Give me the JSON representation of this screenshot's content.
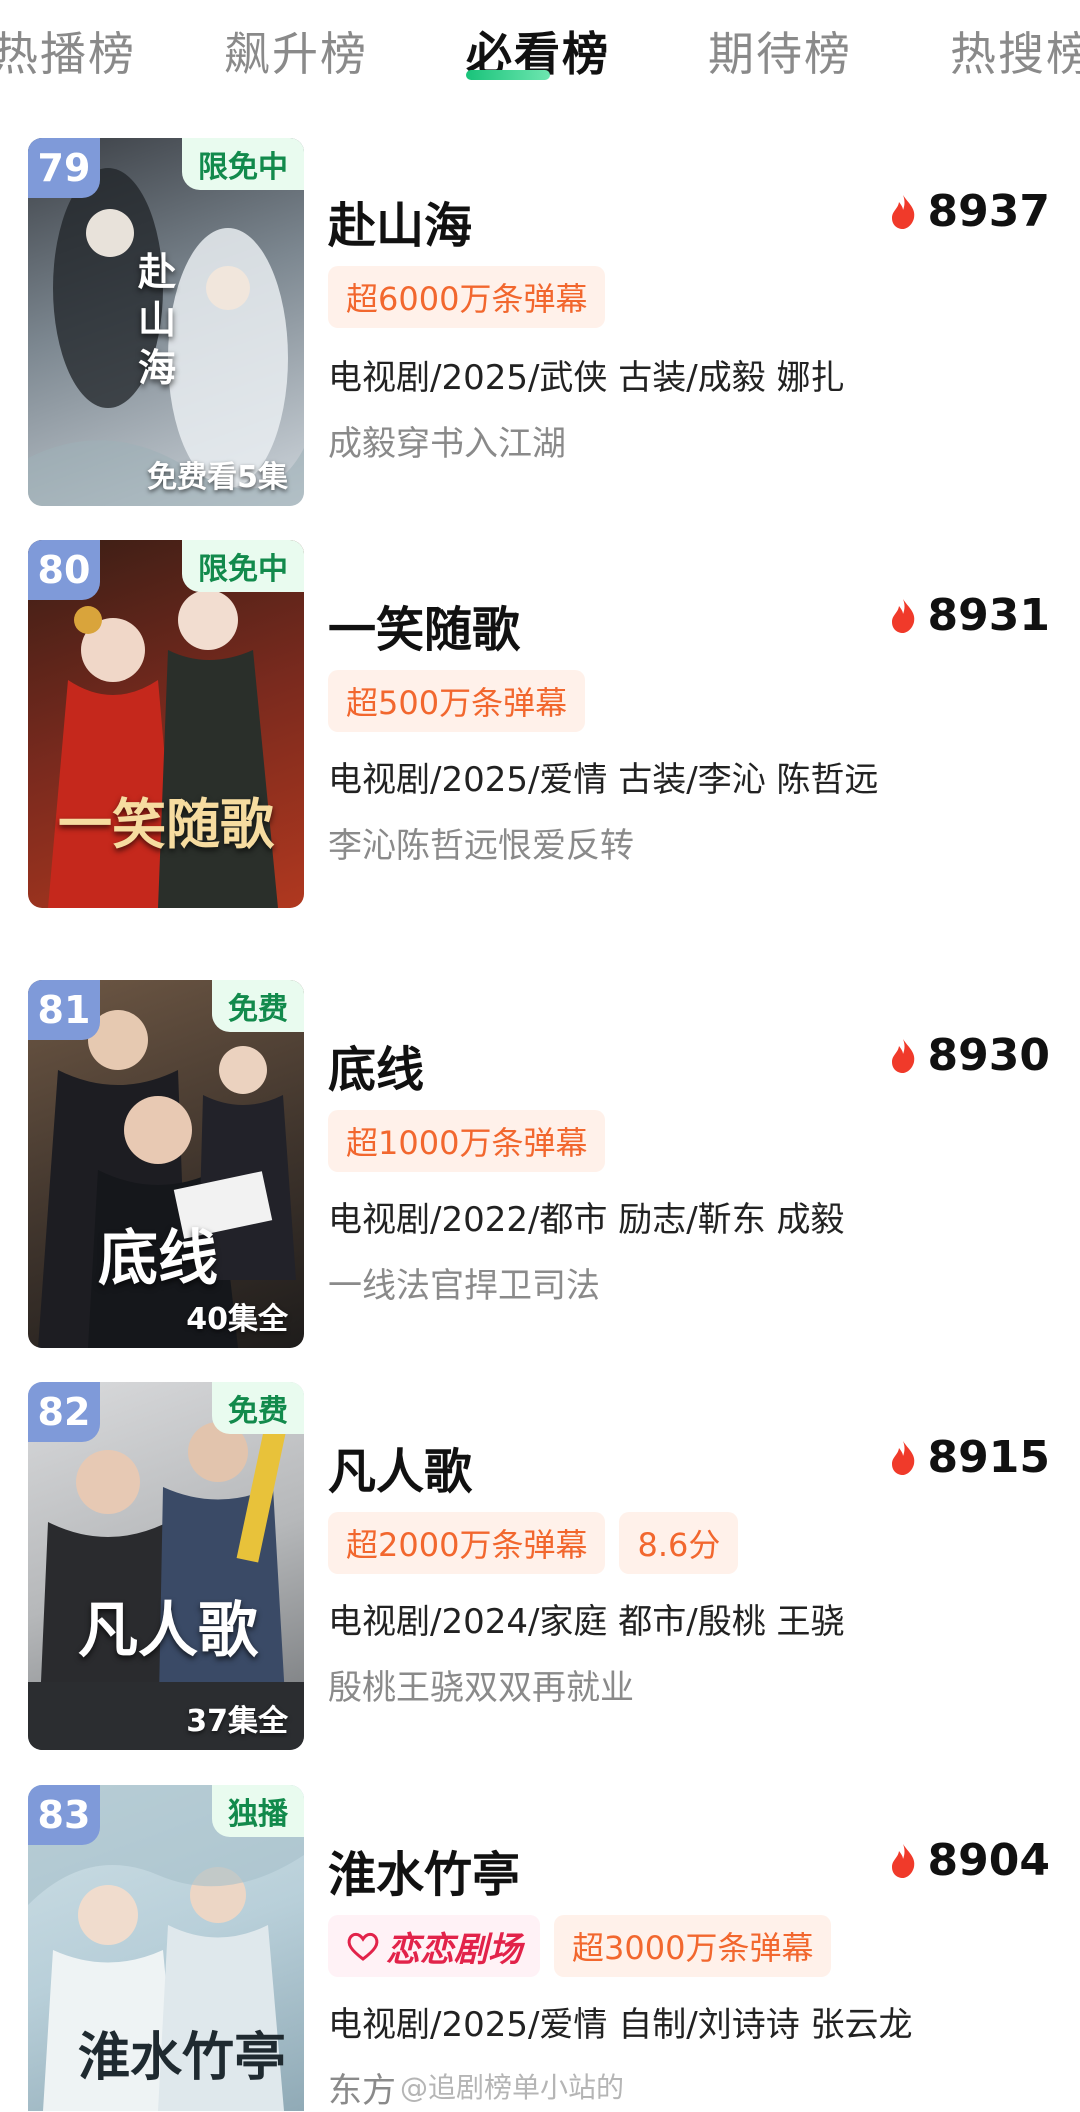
{
  "tabs": [
    "热播榜",
    "飙升榜",
    "必看榜",
    "期待榜",
    "热搜榜"
  ],
  "active_tab": "必看榜",
  "items": [
    {
      "rank": "79",
      "badge": "限免中",
      "poster_text": "赴山海",
      "episodes": "免费看5集",
      "title": "赴山海",
      "heat": "8937",
      "tags": [
        "超6000万条弹幕"
      ],
      "meta": "电视剧/2025/武侠 古装/成毅 娜扎",
      "desc": "成毅穿书入江湖"
    },
    {
      "rank": "80",
      "badge": "限免中",
      "poster_text": "一笑随歌",
      "episodes": "",
      "title": "一笑随歌",
      "heat": "8931",
      "tags": [
        "超500万条弹幕"
      ],
      "meta": "电视剧/2025/爱情 古装/李沁 陈哲远",
      "desc": "李沁陈哲远恨爱反转"
    },
    {
      "rank": "81",
      "badge": "免费",
      "poster_text": "底线",
      "episodes": "40集全",
      "title": "底线",
      "heat": "8930",
      "tags": [
        "超1000万条弹幕"
      ],
      "meta": "电视剧/2022/都市 励志/靳东 成毅",
      "desc": "一线法官捍卫司法"
    },
    {
      "rank": "82",
      "badge": "免费",
      "poster_text": "凡人歌",
      "episodes": "37集全",
      "title": "凡人歌",
      "heat": "8915",
      "tags": [
        "超2000万条弹幕",
        "8.6分"
      ],
      "meta": "电视剧/2024/家庭 都市/殷桃 王骁",
      "desc": "殷桃王骁双双再就业"
    },
    {
      "rank": "83",
      "badge": "独播",
      "poster_text": "淮水竹亭",
      "episodes": "",
      "title": "淮水竹亭",
      "heat": "8904",
      "brand": "恋恋剧场",
      "tags": [
        "超3000万条弹幕"
      ],
      "meta": "电视剧/2025/爱情 自制/刘诗诗 张云龙",
      "desc": "东方"
    }
  ],
  "watermark": "@追剧榜单小站的",
  "colors": {
    "accent_green": "#19c37a",
    "rank_badge": "#7f9ad9",
    "tag_orange": "#f2672e",
    "flame_red": "#f03a2a"
  }
}
